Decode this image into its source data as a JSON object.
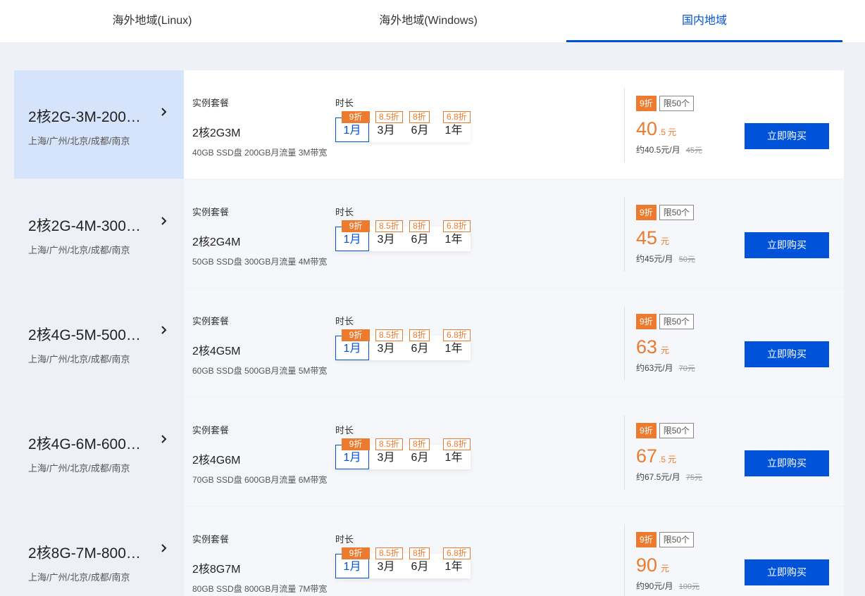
{
  "tabs": [
    {
      "label": "海外地域(Linux)",
      "active": false
    },
    {
      "label": "海外地域(Windows)",
      "active": false
    },
    {
      "label": "国内地域",
      "active": true
    }
  ],
  "labels": {
    "package": "实例套餐",
    "duration": "时长",
    "buy": "立即购买"
  },
  "durations": [
    {
      "label": "1月",
      "discount": "9折"
    },
    {
      "label": "3月",
      "discount": "8.5折"
    },
    {
      "label": "6月",
      "discount": "8折"
    },
    {
      "label": "1年",
      "discount": "6.8折"
    }
  ],
  "selected_duration": "1月",
  "colors": {
    "accent": "#0052d9",
    "discount": "#ed7b2f"
  },
  "products": [
    {
      "name": "2核2G-3M-200G...",
      "regions": "上海/广州/北京/成都/南京",
      "package": "2核2G3M",
      "desc": "40GB SSD盘 200GB月流量 3M带宽",
      "discount_badge": "9折",
      "limit_badge": "限50个",
      "price_int": "40",
      "price_dec": ".5",
      "price_unit": "元",
      "per_month": "约40.5元/月",
      "original": "45元"
    },
    {
      "name": "2核2G-4M-300G...",
      "regions": "上海/广州/北京/成都/南京",
      "package": "2核2G4M",
      "desc": "50GB SSD盘 300GB月流量 4M带宽",
      "discount_badge": "9折",
      "limit_badge": "限50个",
      "price_int": "45",
      "price_dec": "",
      "price_unit": "元",
      "per_month": "约45元/月",
      "original": "50元"
    },
    {
      "name": "2核4G-5M-500G...",
      "regions": "上海/广州/北京/成都/南京",
      "package": "2核4G5M",
      "desc": "60GB SSD盘 500GB月流量 5M带宽",
      "discount_badge": "9折",
      "limit_badge": "限50个",
      "price_int": "63",
      "price_dec": "",
      "price_unit": "元",
      "per_month": "约63元/月",
      "original": "70元"
    },
    {
      "name": "2核4G-6M-600G...",
      "regions": "上海/广州/北京/成都/南京",
      "package": "2核4G6M",
      "desc": "70GB SSD盘 600GB月流量 6M带宽",
      "discount_badge": "9折",
      "limit_badge": "限50个",
      "price_int": "67",
      "price_dec": ".5",
      "price_unit": "元",
      "per_month": "约67.5元/月",
      "original": "75元"
    },
    {
      "name": "2核8G-7M-800G...",
      "regions": "上海/广州/北京/成都/南京",
      "package": "2核8G7M",
      "desc": "80GB SSD盘 800GB月流量 7M带宽",
      "discount_badge": "9折",
      "limit_badge": "限50个",
      "price_int": "90",
      "price_dec": "",
      "price_unit": "元",
      "per_month": "约90元/月",
      "original": "100元"
    }
  ]
}
